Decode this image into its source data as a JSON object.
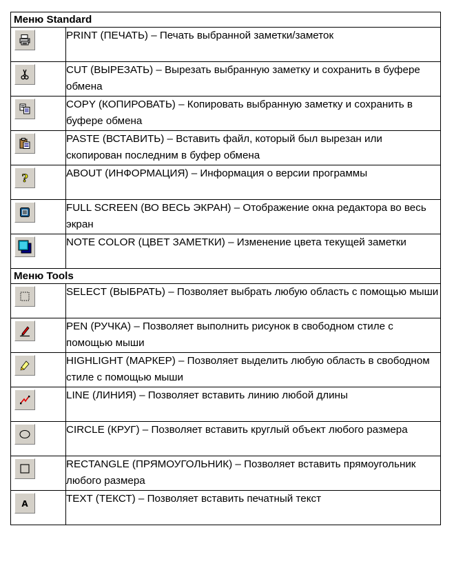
{
  "sections": [
    {
      "title": "Меню Standard",
      "rows": [
        {
          "icon": "printer-icon",
          "name": "PRINT (ПЕЧАТЬ)",
          "desc": "Печать выбранной заметки/заметок"
        },
        {
          "icon": "scissors-icon",
          "name": "CUT (ВЫРЕЗАТЬ)",
          "desc": "Вырезать выбранную заметку и сохранить в буфере обмена"
        },
        {
          "icon": "copy-icon",
          "name": "COPY (КОПИРОВАТЬ)",
          "desc": "Копировать выбранную заметку и сохранить в буфере обмена"
        },
        {
          "icon": "paste-icon",
          "name": "PASTE (ВСТАВИТЬ)",
          "desc": "Вставить файл, который был вырезан или скопирован последним в буфер обмена"
        },
        {
          "icon": "question-mark-icon",
          "name": "ABOUT  (ИНФОРМАЦИЯ)",
          "desc": "Информация о версии программы"
        },
        {
          "icon": "full-screen-icon",
          "name": "FULL SCREEN (ВО ВЕСЬ ЭКРАН) ",
          "desc": "Отображение окна редактора во весь экран"
        },
        {
          "icon": "note-color-icon",
          "name": "NOTE COLOR (ЦВЕТ ЗАМЕТКИ)",
          "desc": "Изменение цвета текущей заметки"
        }
      ]
    },
    {
      "title": "Меню Tools",
      "rows": [
        {
          "icon": "select-marquee-icon",
          "name": "SELECT (ВЫБРАТЬ)",
          "desc": "Позволяет выбрать любую область с помощью мыши"
        },
        {
          "icon": "pen-icon",
          "name": "PEN (РУЧКА)",
          "desc": "Позволяет выполнить рисунок в свободном стиле с помощью мыши"
        },
        {
          "icon": "highlighter-icon",
          "name": "HIGHLIGHT (МАРКЕР)",
          "desc": "Позволяет выделить любую область в свободном стиле с помощью мыши"
        },
        {
          "icon": "line-icon",
          "name": "LINE (ЛИНИЯ)",
          "desc": "Позволяет вставить линию любой длины"
        },
        {
          "icon": "circle-icon",
          "name": "CIRCLE (КРУГ)",
          "desc": "Позволяет вставить круглый объект любого размера"
        },
        {
          "icon": "rectangle-icon",
          "name": "RECTANGLE (ПРЯМОУГОЛЬНИК)",
          "desc": "Позволяет вставить прямоугольник любого размера"
        },
        {
          "icon": "text-icon",
          "name": "TEXT (ТЕКСТ)",
          "desc": "Позволяет вставить печатный текст"
        }
      ]
    }
  ],
  "separator": " – "
}
